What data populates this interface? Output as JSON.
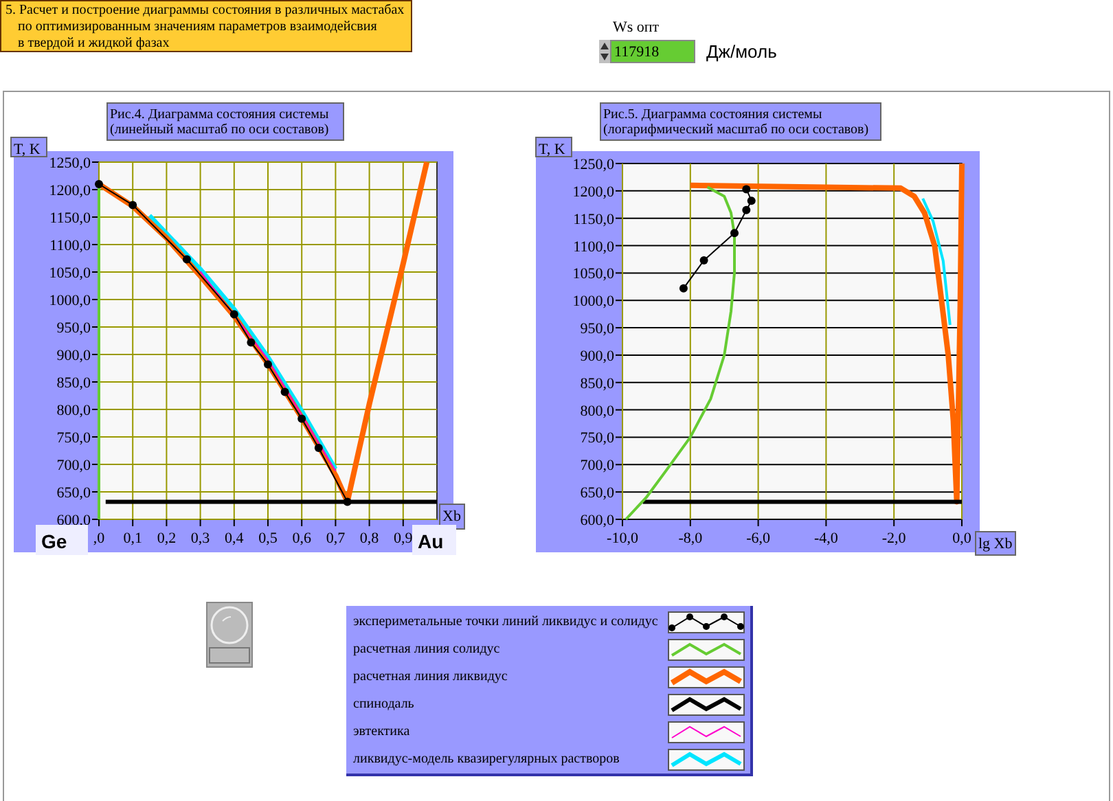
{
  "header": {
    "lines": [
      "5. Расчет и построение диаграммы состояния в различных мастабах",
      "по оптимизированным значениям параметров взаимодейсвия",
      "в твердой и жидкой фазах"
    ]
  },
  "ws_control": {
    "label": "Ws опт",
    "value": "117918",
    "unit": "Дж/моль"
  },
  "charts": [
    {
      "title_lines": [
        "Рис.4. Диаграмма состояния системы",
        "(линейный масштаб по оси составов)"
      ],
      "left_element": "Ge",
      "right_element": "Au",
      "chart_data": {
        "type": "line",
        "ylabel": "T, K",
        "xlabel": "Xb",
        "xlim": [
          0,
          1
        ],
        "ylim": [
          600,
          1250
        ],
        "grid": true,
        "xticks": [
          {
            "value": 0,
            "label": ",0"
          },
          {
            "value": 0.1,
            "label": "0,1"
          },
          {
            "value": 0.2,
            "label": "0,2"
          },
          {
            "value": 0.3,
            "label": "0,3"
          },
          {
            "value": 0.4,
            "label": "0,4"
          },
          {
            "value": 0.5,
            "label": "0,5"
          },
          {
            "value": 0.6,
            "label": "0,6"
          },
          {
            "value": 0.7,
            "label": "0,7"
          },
          {
            "value": 0.8,
            "label": "0,8"
          },
          {
            "value": 0.9,
            "label": "0,9"
          }
        ],
        "yticks": [
          {
            "value": 600,
            "label": "600,0"
          },
          {
            "value": 650,
            "label": "650,0"
          },
          {
            "value": 700,
            "label": "700,0"
          },
          {
            "value": 750,
            "label": "750,0"
          },
          {
            "value": 800,
            "label": "800,0"
          },
          {
            "value": 850,
            "label": "850,0"
          },
          {
            "value": 900,
            "label": "900,0"
          },
          {
            "value": 950,
            "label": "950,0"
          },
          {
            "value": 1000,
            "label": "1000,0"
          },
          {
            "value": 1050,
            "label": "1050,0"
          },
          {
            "value": 1100,
            "label": "1100,0"
          },
          {
            "value": 1150,
            "label": "1150,0"
          },
          {
            "value": 1200,
            "label": "1200,0"
          },
          {
            "value": 1250,
            "label": "1250,0"
          }
        ],
        "series": [
          {
            "name": "экспериметальные точки линий ликвидус и солидус",
            "color": "#000000",
            "marker": "circle",
            "x": [
              0,
              0.1,
              0.26,
              0.4,
              0.45,
              0.5,
              0.55,
              0.6,
              0.65,
              0.735
            ],
            "values": [
              1210,
              1172,
              1073,
              973,
              922,
              882,
              832,
              783,
              730,
              632
            ]
          },
          {
            "name": "расчетная линия солидус",
            "color": "#66cc33",
            "x": [
              0,
              0
            ],
            "values": [
              600,
              1210
            ]
          },
          {
            "name": "расчетная линия ликвидус",
            "color": "#ff6600",
            "x": [
              0,
              0.1,
              0.2,
              0.3,
              0.4,
              0.5,
              0.6,
              0.7,
              0.735,
              0.8,
              0.9,
              0.97
            ],
            "values": [
              1210,
              1170,
              1112,
              1043,
              970,
              883,
              785,
              680,
              632,
              810,
              1065,
              1250
            ]
          },
          {
            "name": "спинодаль",
            "color": "#000000",
            "x": [
              0.02,
              1.0
            ],
            "values": [
              632,
              632
            ]
          },
          {
            "name": "эвтектика",
            "color": "#ff00cc",
            "x": [
              0.3,
              0.5,
              0.7
            ],
            "values": [
              1051,
              891,
              688
            ]
          },
          {
            "name": "ликвидус-модель квазирегулярных растворов",
            "color": "#00e5ff",
            "x": [
              0.15,
              0.3,
              0.4,
              0.5,
              0.6,
              0.65,
              0.7
            ],
            "values": [
              1153,
              1056,
              983,
              896,
              798,
              745,
              692
            ]
          }
        ]
      }
    },
    {
      "title_lines": [
        "Рис.5. Диаграмма состояния системы",
        "(логарифмический масштаб по оси составов)"
      ],
      "chart_data": {
        "type": "line",
        "ylabel": "T, K",
        "xlabel": "lg Xb",
        "xlim": [
          -10,
          0
        ],
        "ylim": [
          600,
          1250
        ],
        "grid": true,
        "xticks": [
          {
            "value": -10,
            "label": "-10,0"
          },
          {
            "value": -8,
            "label": "-8,0"
          },
          {
            "value": -6,
            "label": "-6,0"
          },
          {
            "value": -4,
            "label": "-4,0"
          },
          {
            "value": -2,
            "label": "-2,0"
          },
          {
            "value": 0,
            "label": "0,0"
          }
        ],
        "yticks": [
          {
            "value": 600,
            "label": "600,0"
          },
          {
            "value": 650,
            "label": "650,0"
          },
          {
            "value": 700,
            "label": "700,0"
          },
          {
            "value": 750,
            "label": "750,0"
          },
          {
            "value": 800,
            "label": "800,0"
          },
          {
            "value": 850,
            "label": "850,0"
          },
          {
            "value": 900,
            "label": "900,0"
          },
          {
            "value": 950,
            "label": "950,0"
          },
          {
            "value": 1000,
            "label": "1000,0"
          },
          {
            "value": 1050,
            "label": "1050,0"
          },
          {
            "value": 1100,
            "label": "1100,0"
          },
          {
            "value": 1150,
            "label": "1150,0"
          },
          {
            "value": 1200,
            "label": "1200,0"
          },
          {
            "value": 1250,
            "label": "1250,0"
          }
        ],
        "series": [
          {
            "color": "#000000",
            "marker": "circle",
            "x": [
              -8.2,
              -7.6,
              -6.7,
              -6.35,
              -6.2,
              -6.35
            ],
            "values": [
              1022,
              1073,
              1123,
              1165,
              1182,
              1203
            ]
          },
          {
            "color": "#66cc33",
            "x": [
              -7.5,
              -7.0,
              -6.8,
              -6.7,
              -6.7,
              -6.8,
              -7.0,
              -7.4,
              -8.0,
              -8.7,
              -9.3,
              -9.9
            ],
            "values": [
              1207,
              1190,
              1160,
              1120,
              1050,
              980,
              900,
              820,
              750,
              690,
              640,
              600
            ]
          },
          {
            "color": "#ff6600",
            "x": [
              -8,
              -3.3,
              -1.8,
              -1.4,
              -1.1,
              -0.8,
              -0.6,
              -0.4,
              -0.25,
              -0.15,
              -0.05,
              0
            ],
            "values": [
              1210,
              1206,
              1205,
              1190,
              1160,
              1100,
              1000,
              900,
              780,
              632,
              990,
              1250
            ]
          },
          {
            "color": "#000000",
            "x": [
              -9.4,
              0
            ],
            "values": [
              632,
              632
            ]
          },
          {
            "color": "#00e5ff",
            "x": [
              -1.15,
              -0.85,
              -0.55,
              -0.35
            ],
            "values": [
              1186,
              1145,
              1072,
              955
            ]
          }
        ]
      }
    }
  ]
}
